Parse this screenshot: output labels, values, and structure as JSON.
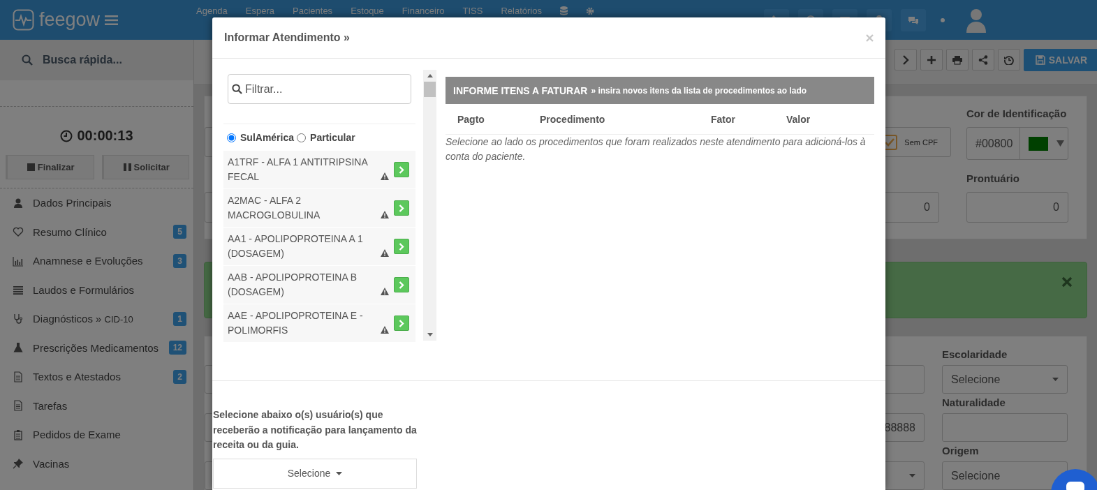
{
  "topbar": {
    "logo": "feegow",
    "nav": [
      "Agenda",
      "Espera",
      "Pacientes",
      "Estoque",
      "Financeiro",
      "TISS",
      "Relatórios"
    ]
  },
  "sidebar": {
    "search_placeholder": "Busca rápida...",
    "timer": "00:00:13",
    "actions": [
      {
        "label": "Finalizar"
      },
      {
        "label": "Solicitar"
      }
    ],
    "items": [
      {
        "label": "Dados Principais"
      },
      {
        "label": "Resumo Clínico",
        "badge": "5"
      },
      {
        "label": "Anamnese e Evoluções",
        "badge": "3"
      },
      {
        "label": "Laudos e Formulários"
      },
      {
        "label": "Diagnósticos »",
        "sub": "CID-10",
        "badge": "1"
      },
      {
        "label": "Prescrições Medicamentos",
        "badge": "12"
      },
      {
        "label": "Textos e Atestados",
        "badge": "2"
      },
      {
        "label": "Tarefas"
      },
      {
        "label": "Pedidos de Exame"
      },
      {
        "label": "Vacinas"
      }
    ]
  },
  "toolbar": {
    "save": "SALVAR"
  },
  "form": {
    "no_cpf": {
      "label": "Sem CPF",
      "checked": true
    },
    "color_id": {
      "label": "Cor de Identificação",
      "value": "#00800"
    },
    "number_value": "0",
    "record": {
      "label": "Prontuário",
      "value": "0"
    },
    "phone_value": "88888",
    "education": {
      "label": "Escolaridade",
      "value": "Selecione"
    },
    "birthplace": {
      "label": "Naturalidade"
    },
    "origin": {
      "label": "Origem",
      "value": "Selecione"
    }
  },
  "modal": {
    "title": "Informar Atendimento »",
    "filter_placeholder": "Filtrar...",
    "plans": [
      {
        "label": "SulAmérica",
        "selected": true
      },
      {
        "label": "Particular",
        "selected": false
      }
    ],
    "procedures": [
      "A1TRF - ALFA 1 ANTITRIPSINA FECAL",
      "A2MAC - ALFA 2 MACROGLOBULINA",
      "AA1 - APOLIPOPROTEINA A 1 (DOSAGEM)",
      "AAB - APOLIPOPROTEINA B (DOSAGEM)",
      "AAE - APOLIPOPROTEINA E - POLIMORFIS"
    ],
    "billing": {
      "title": "INFORME ITENS A FATURAR",
      "subtitle": "» insira novos itens da lista de procedimentos ao lado",
      "columns": [
        "Pagto",
        "Procedimento",
        "Fator",
        "Valor"
      ],
      "empty": "Selecione ao lado os procedimentos que foram realizados neste atendimento para adicioná-los à conta do paciente."
    },
    "notify_text": "Selecione abaixo o(s) usuário(s) que receberão a notificação para lançamento da receita ou da guia.",
    "notify_select": "Selecione"
  }
}
